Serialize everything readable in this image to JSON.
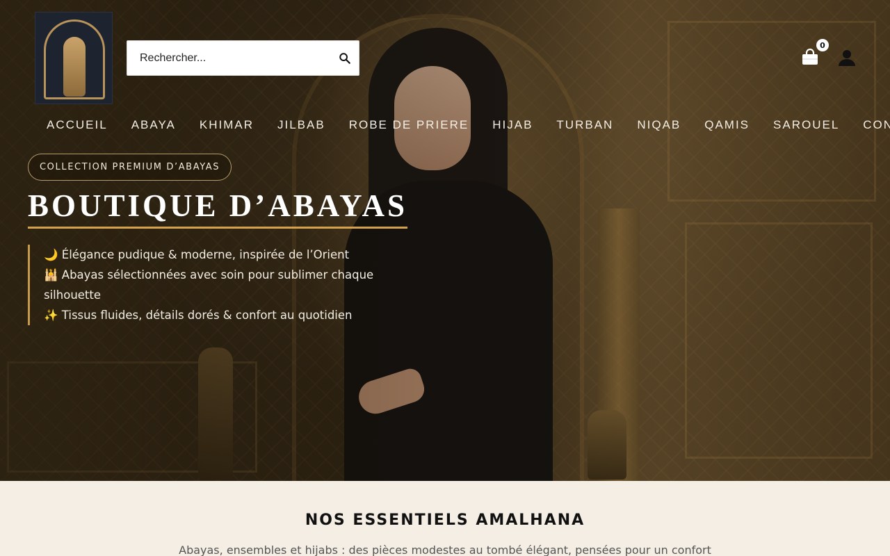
{
  "header": {
    "logo_alt": "Amalhana logo",
    "search": {
      "placeholder": "Rechercher..."
    },
    "cart": {
      "count": "0"
    }
  },
  "nav": {
    "items": [
      "ACCUEIL",
      "ABAYA",
      "KHIMAR",
      "JILBAB",
      "ROBE DE PRIERE",
      "HIJAB",
      "TURBAN",
      "NIQAB",
      "QAMIS",
      "SAROUEL",
      "CONT"
    ]
  },
  "hero": {
    "badge": "COLLECTION PREMIUM D’ABAYAS",
    "title": "BOUTIQUE D’ABAYAS",
    "features": [
      {
        "icon": "🌙",
        "text": "Élégance pudique & moderne, inspirée de l’Orient"
      },
      {
        "icon": "🕌",
        "text": "Abayas sélectionnées avec soin pour sublimer chaque silhouette"
      },
      {
        "icon": "✨",
        "text": "Tissus fluides, détails dorés & confort au quotidien"
      }
    ]
  },
  "section": {
    "title": "NOS ESSENTIELS AMALHANA",
    "description": "Abayas, ensembles et hijabs : des pièces modestes au tombé élégant, pensées pour un confort"
  },
  "colors": {
    "accent_gold": "#d4a24c",
    "section_bg": "#f4eee4"
  }
}
